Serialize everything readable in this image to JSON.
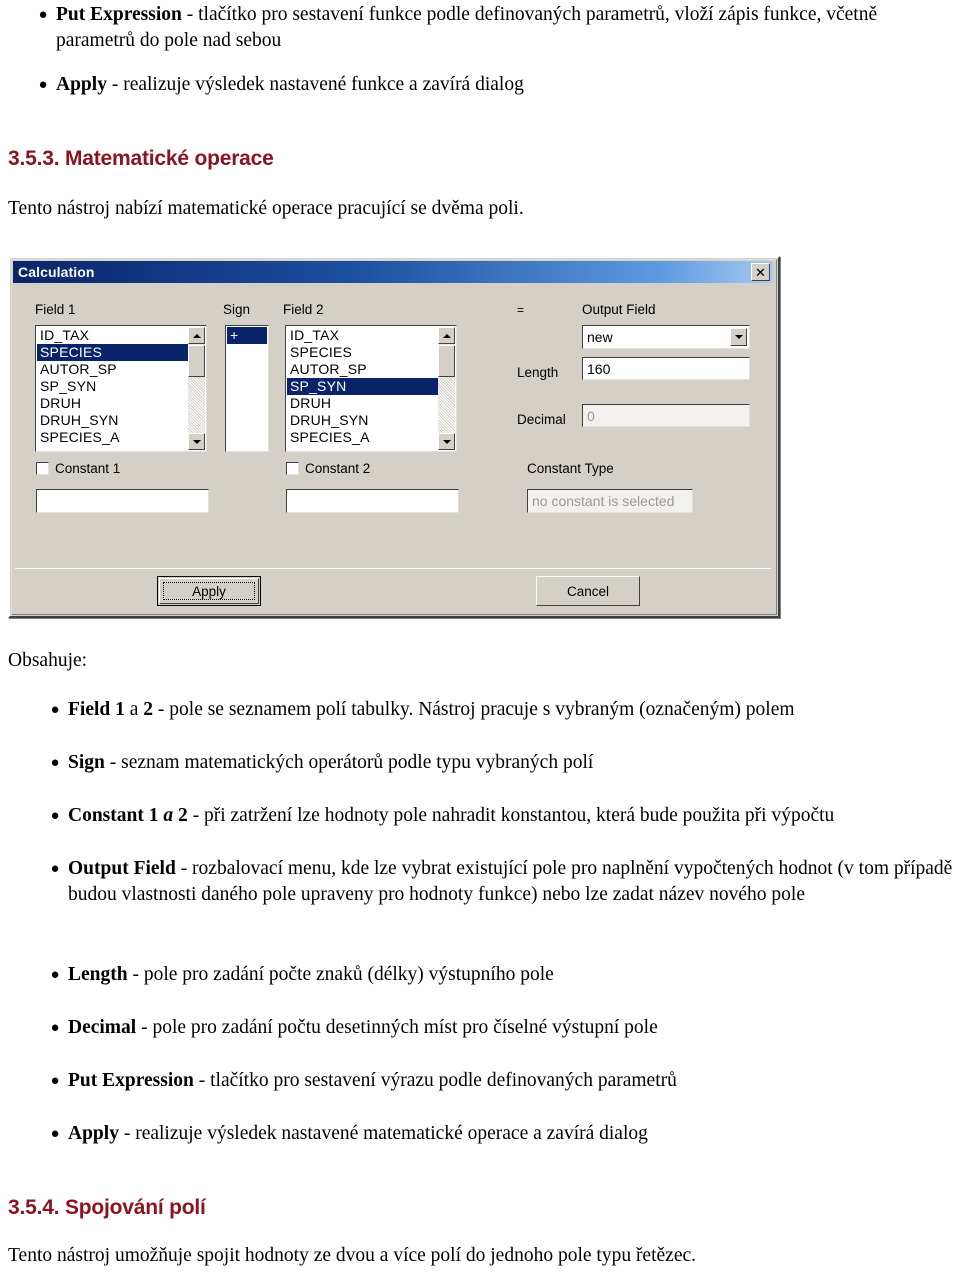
{
  "document": {
    "top_bullets": [
      {
        "bold": "Put Expression",
        "rest": " - tlačítko pro sestavení funkce podle definovaných parametrů, vloží zápis funkce, včetně parametrů do pole nad sebou"
      },
      {
        "bold": "Apply",
        "rest": " - realizuje výsledek nastavené funkce a zavírá dialog"
      }
    ],
    "heading_353": "3.5.3. Matematické operace",
    "intro_353": "Tento nástroj nabízí matematické operace pracující se dvěma poli.",
    "contains_label": "Obsahuje:",
    "contains_bullets": [
      {
        "bold": "Field 1",
        "italic_mid": " a ",
        "bold2": "2",
        "rest": " - pole se seznamem polí tabulky. Nástroj pracuje s vybraným (označeným) polem"
      },
      {
        "bold": "Sign",
        "rest": " - seznam matematických operátorů podle typu vybraných polí"
      },
      {
        "bold": "Constant 1",
        "italic_mid": " a ",
        "bold2": "2",
        "rest": " - při zatržení lze hodnoty pole nahradit konstantou, která bude použita při výpočtu"
      },
      {
        "bold": "Output Field",
        "rest": " - rozbalovací menu, kde lze vybrat existující pole pro naplnění vypočtených hodnot (v tom případě budou vlastnosti daného pole upraveny pro hodnoty funkce) nebo lze zadat název nového pole"
      },
      {
        "bold": "Length",
        "rest": " - pole pro zadání počte znaků (délky) výstupního pole"
      },
      {
        "bold": "Decimal",
        "rest": " - pole pro zadání počtu desetinných míst pro číselné výstupní pole"
      },
      {
        "bold": "Put Expression",
        "rest": " - tlačítko pro sestavení výrazu podle definovaných parametrů"
      },
      {
        "bold": "Apply",
        "rest": " - realizuje výsledek nastavené matematické operace a zavírá dialog"
      }
    ],
    "heading_354": "3.5.4. Spojování polí",
    "intro_354": "Tento nástroj umožňuje spojit hodnoty ze dvou a více polí do jednoho pole typu řetězec."
  },
  "dialog": {
    "title": "Calculation",
    "close_label": "✕",
    "labels": {
      "field1": "Field 1",
      "sign": "Sign",
      "field2": "Field 2",
      "equals": "=",
      "output_field": "Output Field",
      "length": "Length",
      "decimal": "Decimal",
      "constant1": "Constant 1",
      "constant2": "Constant 2",
      "constant_type": "Constant Type"
    },
    "field1_list": {
      "items": [
        "ID_TAX",
        "SPECIES",
        "AUTOR_SP",
        "SP_SYN",
        "DRUH",
        "DRUH_SYN",
        "SPECIES_A"
      ],
      "selected": "SPECIES"
    },
    "sign_list": {
      "items": [
        "+"
      ],
      "selected": "+"
    },
    "field2_list": {
      "items": [
        "ID_TAX",
        "SPECIES",
        "AUTOR_SP",
        "SP_SYN",
        "DRUH",
        "DRUH_SYN",
        "SPECIES_A"
      ],
      "selected": "SP_SYN"
    },
    "output_field_value": "new",
    "length_value": "160",
    "decimal_value": "0",
    "constant1_value": "",
    "constant2_value": "",
    "constant_type_value": "no constant is selected",
    "constant1_checked": false,
    "constant2_checked": false,
    "buttons": {
      "apply": "Apply",
      "cancel": "Cancel"
    },
    "colors": {
      "titlebar_start": "#0a246a",
      "titlebar_end": "#a6caf0",
      "face": "#d4d0c8",
      "selection": "#0a246a"
    }
  }
}
